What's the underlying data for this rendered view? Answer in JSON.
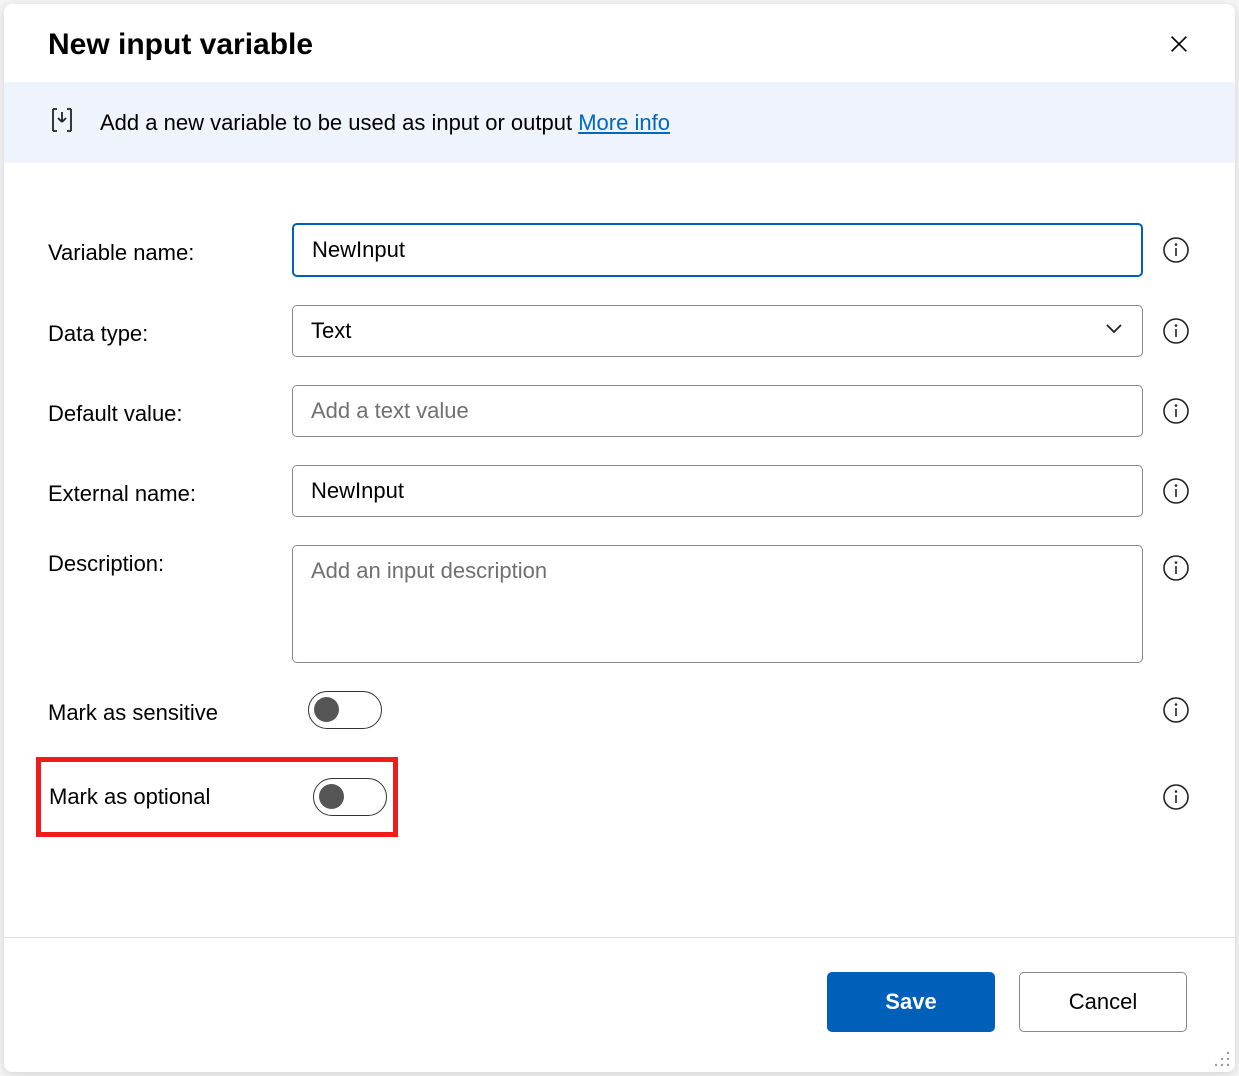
{
  "dialog": {
    "title": "New input variable",
    "banner": {
      "text": "Add a new variable to be used as input or output ",
      "link": "More info"
    }
  },
  "form": {
    "variable_name": {
      "label": "Variable name:",
      "value": "NewInput"
    },
    "data_type": {
      "label": "Data type:",
      "value": "Text"
    },
    "default_value": {
      "label": "Default value:",
      "value": "",
      "placeholder": "Add a text value"
    },
    "external_name": {
      "label": "External name:",
      "value": "NewInput"
    },
    "description": {
      "label": "Description:",
      "value": "",
      "placeholder": "Add an input description"
    },
    "mark_sensitive": {
      "label": "Mark as sensitive",
      "on": false
    },
    "mark_optional": {
      "label": "Mark as optional",
      "on": false
    }
  },
  "buttons": {
    "save": "Save",
    "cancel": "Cancel"
  }
}
